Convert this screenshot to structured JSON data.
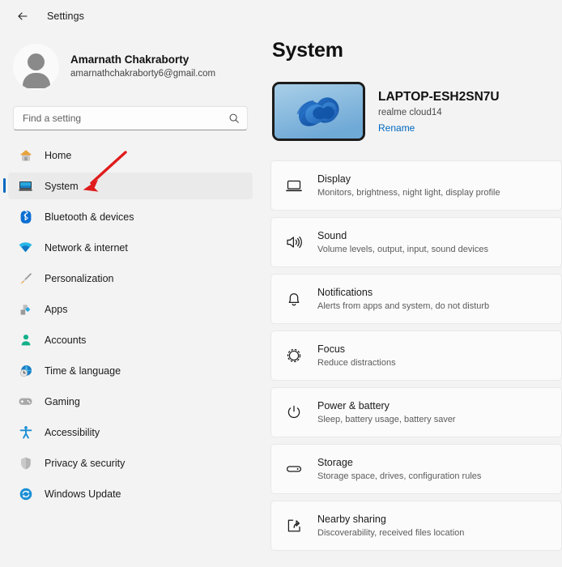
{
  "titlebar": {
    "back_icon": "back-arrow-icon",
    "title": "Settings"
  },
  "sidebar": {
    "account": {
      "avatar_icon": "person-avatar-icon",
      "name": "Amarnath Chakraborty",
      "email": "amarnathchakraborty6@gmail.com"
    },
    "search": {
      "placeholder": "Find a setting",
      "value": "",
      "icon": "search-icon"
    },
    "items": [
      {
        "label": "Home",
        "icon": "home-icon",
        "selected": false
      },
      {
        "label": "System",
        "icon": "system-monitor-icon",
        "selected": true
      },
      {
        "label": "Bluetooth & devices",
        "icon": "bluetooth-icon",
        "selected": false
      },
      {
        "label": "Network & internet",
        "icon": "wifi-icon",
        "selected": false
      },
      {
        "label": "Personalization",
        "icon": "paintbrush-icon",
        "selected": false
      },
      {
        "label": "Apps",
        "icon": "apps-icon",
        "selected": false
      },
      {
        "label": "Accounts",
        "icon": "person-icon",
        "selected": false
      },
      {
        "label": "Time & language",
        "icon": "clock-globe-icon",
        "selected": false
      },
      {
        "label": "Gaming",
        "icon": "gamepad-icon",
        "selected": false
      },
      {
        "label": "Accessibility",
        "icon": "accessibility-icon",
        "selected": false
      },
      {
        "label": "Privacy & security",
        "icon": "shield-icon",
        "selected": false
      },
      {
        "label": "Windows Update",
        "icon": "update-refresh-icon",
        "selected": false
      }
    ]
  },
  "main": {
    "page_title": "System",
    "device": {
      "thumbnail_icon": "windows-bloom-wallpaper-tablet",
      "name": "LAPTOP-ESH2SN7U",
      "model": "realme cloud14",
      "rename_label": "Rename"
    },
    "cards": [
      {
        "title": "Display",
        "subtitle": "Monitors, brightness, night light, display profile",
        "icon": "monitor-icon"
      },
      {
        "title": "Sound",
        "subtitle": "Volume levels, output, input, sound devices",
        "icon": "speaker-icon"
      },
      {
        "title": "Notifications",
        "subtitle": "Alerts from apps and system, do not disturb",
        "icon": "bell-icon"
      },
      {
        "title": "Focus",
        "subtitle": "Reduce distractions",
        "icon": "focus-moon-icon"
      },
      {
        "title": "Power & battery",
        "subtitle": "Sleep, battery usage, battery saver",
        "icon": "power-icon"
      },
      {
        "title": "Storage",
        "subtitle": "Storage space, drives, configuration rules",
        "icon": "storage-drive-icon"
      },
      {
        "title": "Nearby sharing",
        "subtitle": "Discoverability, received files location",
        "icon": "nearby-share-icon"
      }
    ]
  },
  "annotation": {
    "arrow_icon": "red-arrow-annotation",
    "color": "#e01b1b",
    "points_to": "System"
  },
  "colors": {
    "accent": "#0067c0",
    "page_background": "#f3f3f3",
    "card_background": "#fbfbfb",
    "selection_background": "#eaeaea",
    "annotation_red": "#e01b1b"
  }
}
